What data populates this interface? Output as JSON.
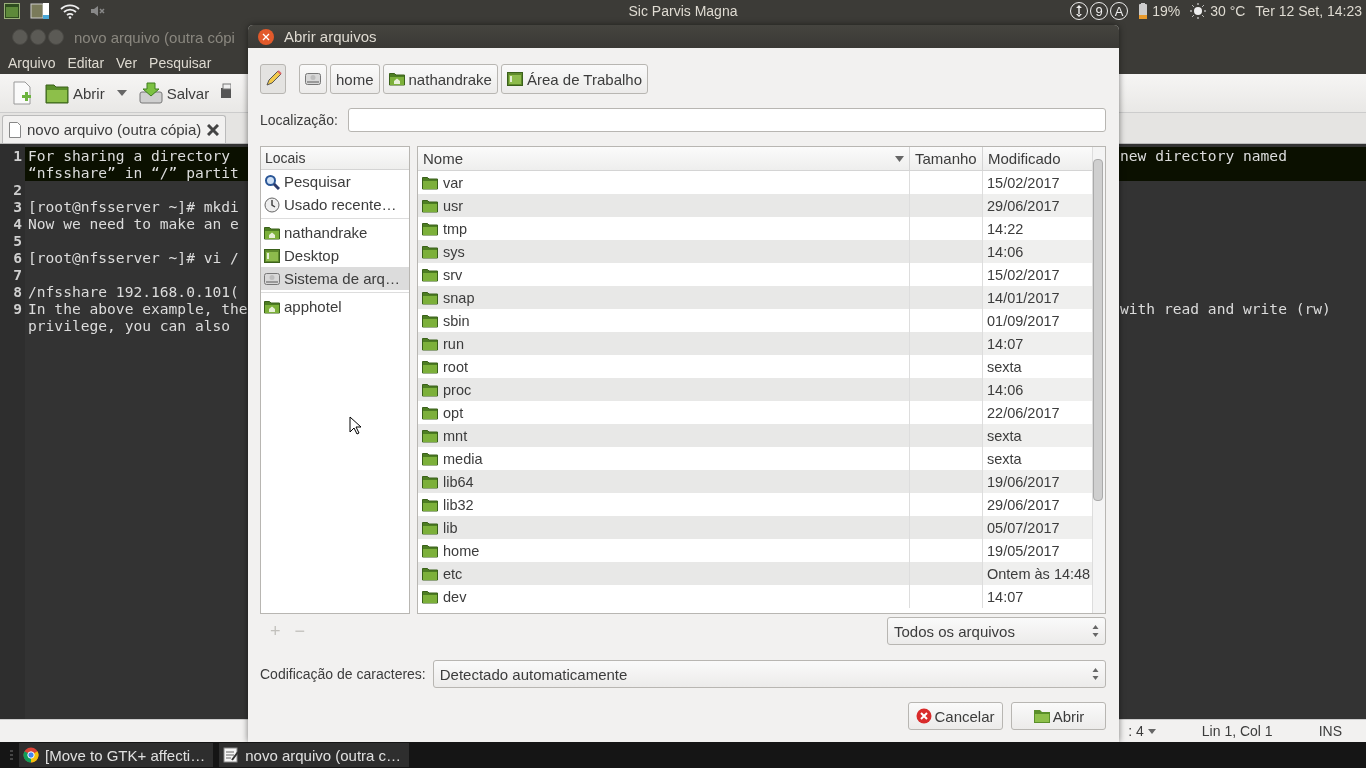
{
  "top_panel": {
    "title": "Sic Parvis Magna",
    "indicators": [
      "9",
      "A"
    ],
    "battery": "19%",
    "weather": "30 °C",
    "clock": "Ter 12 Set, 14:23"
  },
  "editor": {
    "title": "novo arquivo (outra cópi",
    "menu": [
      "Arquivo",
      "Editar",
      "Ver",
      "Pesquisar"
    ],
    "toolbar": [
      {
        "kind": "new"
      },
      {
        "kind": "open",
        "label": "Abrir"
      },
      {
        "kind": "dropdown"
      },
      {
        "kind": "save",
        "label": "Salvar"
      },
      {
        "kind": "print"
      }
    ],
    "tab": {
      "label": "novo arquivo (outra cópia)"
    },
    "lines": [
      {
        "number": "1",
        "current": true,
        "left": [
          "For sharing a directory",
          "“nfsshare” in “/” partit"
        ],
        "right": [
          "new directory named"
        ]
      },
      {
        "number": "2",
        "current": false
      },
      {
        "number": "3",
        "current": false,
        "left": [
          "[root@nfsserver ~]# mkdi"
        ]
      },
      {
        "number": "4",
        "current": false,
        "left": [
          "Now we need to make an e"
        ]
      },
      {
        "number": "5",
        "current": false
      },
      {
        "number": "6",
        "current": false,
        "left": [
          "[root@nfsserver ~]# vi /"
        ]
      },
      {
        "number": "7",
        "current": false
      },
      {
        "number": "8",
        "current": false,
        "left": [
          "/nfsshare 192.168.0.101("
        ]
      },
      {
        "number": "9",
        "current": false,
        "left": [
          "In the above example, the",
          "privilege, you can also"
        ],
        "right": [
          "with read and write (rw)"
        ]
      }
    ],
    "status": [
      ": 4",
      "Lin 1, Col 1",
      "INS"
    ]
  },
  "dialog": {
    "title": "Abrir arquivos",
    "path": [
      {
        "kind": "drive"
      },
      {
        "kind": "plain",
        "label": "home"
      },
      {
        "kind": "home",
        "label": "nathandrake"
      },
      {
        "kind": "desktop",
        "label": "Área de Trabalho"
      }
    ],
    "location_label": "Localização:",
    "places": {
      "header": "Locais",
      "groups": [
        [
          {
            "kind": "search",
            "label": "Pesquisar",
            "selected": false
          },
          {
            "kind": "recent",
            "label": "Usado recente…",
            "selected": false
          }
        ],
        [
          {
            "kind": "home",
            "label": "nathandrake",
            "selected": false
          },
          {
            "kind": "desktop",
            "label": "Desktop",
            "selected": false
          },
          {
            "kind": "drive",
            "label": "Sistema de arq…",
            "selected": true
          }
        ],
        [
          {
            "kind": "home",
            "label": "apphotel",
            "selected": false
          }
        ]
      ]
    },
    "place_buttons": [
      {
        "label": "+",
        "disabled": true
      },
      {
        "label": "−",
        "disabled": true
      }
    ],
    "columns": [
      "Nome",
      "Tamanho",
      "Modificado"
    ],
    "rows": [
      {
        "name": "var",
        "modified": "15/02/2017"
      },
      {
        "name": "usr",
        "modified": "29/06/2017"
      },
      {
        "name": "tmp",
        "modified": "14:22"
      },
      {
        "name": "sys",
        "modified": "14:06"
      },
      {
        "name": "srv",
        "modified": "15/02/2017"
      },
      {
        "name": "snap",
        "modified": "14/01/2017"
      },
      {
        "name": "sbin",
        "modified": "01/09/2017"
      },
      {
        "name": "run",
        "modified": "14:07"
      },
      {
        "name": "root",
        "modified": "sexta"
      },
      {
        "name": "proc",
        "modified": "14:06"
      },
      {
        "name": "opt",
        "modified": "22/06/2017"
      },
      {
        "name": "mnt",
        "modified": "sexta"
      },
      {
        "name": "media",
        "modified": "sexta"
      },
      {
        "name": "lib64",
        "modified": "19/06/2017"
      },
      {
        "name": "lib32",
        "modified": "29/06/2017"
      },
      {
        "name": "lib",
        "modified": "05/07/2017"
      },
      {
        "name": "home",
        "modified": "19/05/2017"
      },
      {
        "name": "etc",
        "modified": "Ontem às 14:48"
      },
      {
        "name": "dev",
        "modified": "14:07"
      }
    ],
    "filter": "Todos os arquivos",
    "encoding": {
      "label": "Codificação de caracteres:",
      "value": "Detectado automaticamente"
    },
    "buttons": [
      {
        "kind": "cancel",
        "label": "Cancelar"
      },
      {
        "kind": "open",
        "label": "Abrir"
      }
    ]
  },
  "taskbar": [
    {
      "kind": "browser",
      "label": "[Move to GTK+ affecti…"
    },
    {
      "kind": "editor",
      "label": "novo arquivo (outra c…"
    }
  ]
}
